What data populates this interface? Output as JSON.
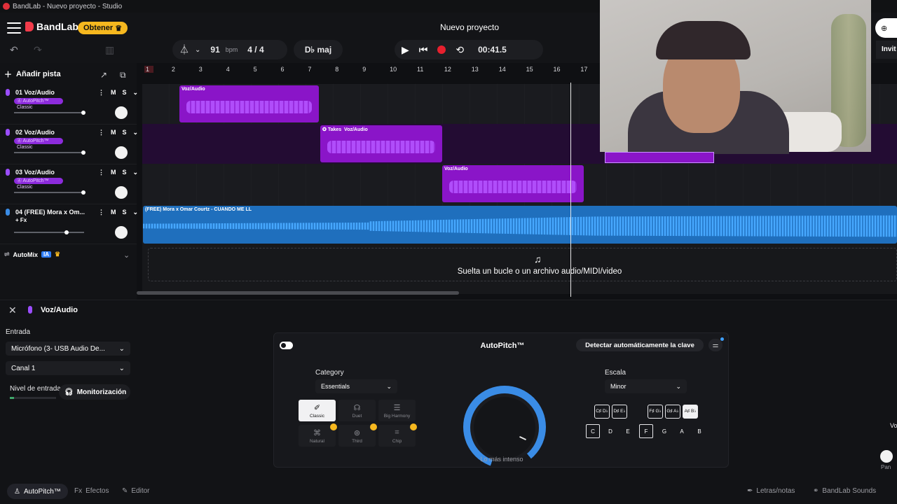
{
  "window": {
    "title": "BandLab - Nuevo proyecto - Studio"
  },
  "header": {
    "brand": "BandLab",
    "obtener_label": "Obtener",
    "project_title": "Nuevo proyecto",
    "tempo_value": "91",
    "tempo_unit": "bpm",
    "time_signature": "4 / 4",
    "key": "D♭ maj",
    "time_display": "00:41.5",
    "share_invite": "Invit"
  },
  "tracklist": {
    "add_track_label": "Añadir pista",
    "tracks": [
      {
        "name": "01  Voz/Audio",
        "fx_tag": "Ⓐ AutoPitch™ Classic",
        "volume": 0.8
      },
      {
        "name": "02  Voz/Audio",
        "fx_tag": "Ⓐ AutoPitch™ Classic",
        "volume": 0.8
      },
      {
        "name": "03  Voz/Audio",
        "fx_tag": "Ⓐ AutoPitch™ Classic",
        "volume": 0.8
      },
      {
        "name": "04  (FREE) Mora x Om...",
        "fx_tag": "+ Fx",
        "volume": 0.6
      }
    ],
    "mute_label": "M",
    "solo_label": "S",
    "automix_label": "AutoMix",
    "ia_label": "IA"
  },
  "ruler": {
    "bars": [
      "1",
      "2",
      "3",
      "4",
      "5",
      "6",
      "7",
      "8",
      "9",
      "10",
      "11",
      "12",
      "13",
      "14",
      "15",
      "16",
      "17"
    ]
  },
  "clips": {
    "clip1": "Voz/Audio",
    "clip2_takes": "Takes",
    "clip2": "Voz/Audio",
    "clip3": "Voz/Audio",
    "clip4": "(FREE) Mora x Omar Courtz - CUANDO ME LL"
  },
  "dropzone": {
    "text": "Suelta un bucle o un archivo audio/MIDI/video"
  },
  "panel": {
    "track_title": "Voz/Audio",
    "entrada_label": "Entrada",
    "input_device": "Micrófono (3- USB Audio De...",
    "channel": "Canal 1",
    "level_label": "Nivel de entrada",
    "monitor_label": "Monitorización",
    "pan_label": "Pan",
    "vol_label": "Vo"
  },
  "autopitch": {
    "title": "AutoPitch™",
    "detect_label": "Detectar automáticamente la clave",
    "category_label": "Category",
    "category_value": "Essentials",
    "voices": [
      "Classic",
      "Duet",
      "Big Harmony",
      "Natural",
      "Third",
      "Chip"
    ],
    "dial_label": "Lo más intenso",
    "scale_label": "Escala",
    "scale_value": "Minor",
    "accidentals": [
      "C♯ D♭",
      "D♯ E♭",
      "F♯ G♭",
      "G♯ A♭",
      "A♯ B♭"
    ],
    "notes": [
      "C",
      "D",
      "E",
      "F",
      "G",
      "A",
      "B"
    ]
  },
  "bottom_tabs": {
    "autopitch": "AutoPitch™",
    "efectos": "Efectos",
    "editor": "Editor",
    "letras": "Letras/notas",
    "sounds": "BandLab Sounds"
  },
  "colors": {
    "accent_purple": "#8a15c8",
    "accent_blue": "#1f6fbd",
    "brand_red": "#f23b4a",
    "gold": "#f6b81f"
  }
}
